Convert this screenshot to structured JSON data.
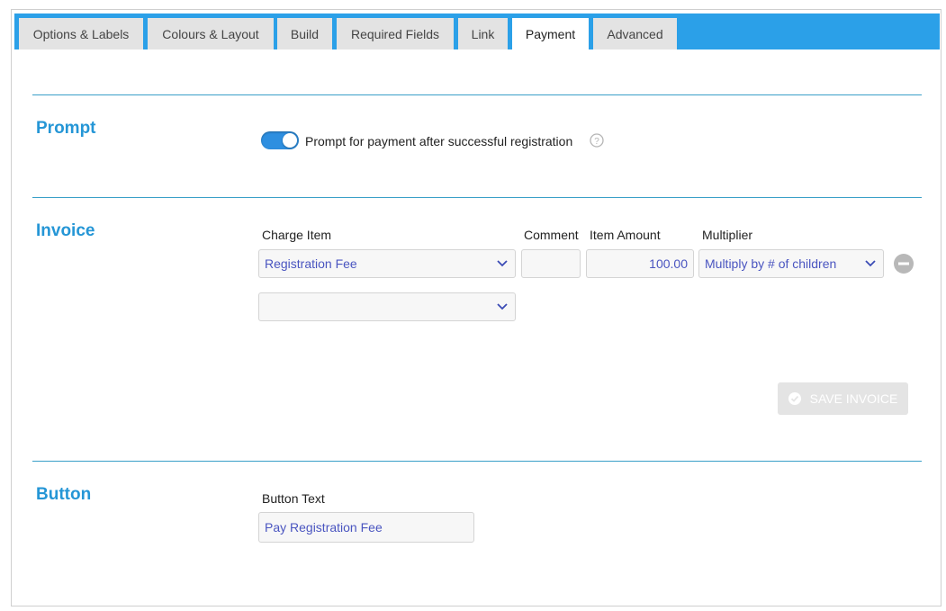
{
  "tabs": [
    {
      "label": "Options & Labels",
      "active": false
    },
    {
      "label": "Colours & Layout",
      "active": false
    },
    {
      "label": "Build",
      "active": false
    },
    {
      "label": "Required Fields",
      "active": false
    },
    {
      "label": "Link",
      "active": false
    },
    {
      "label": "Payment",
      "active": true
    },
    {
      "label": "Advanced",
      "active": false
    }
  ],
  "prompt": {
    "title": "Prompt",
    "toggle_on": true,
    "toggle_label": "Prompt for payment after successful registration",
    "help_icon": "question-circle-icon"
  },
  "invoice": {
    "title": "Invoice",
    "headers": {
      "charge_item": "Charge Item",
      "comment": "Comment",
      "item_amount": "Item Amount",
      "multiplier": "Multiplier"
    },
    "rows": [
      {
        "charge_item": "Registration Fee",
        "comment": "",
        "item_amount": "100.00",
        "multiplier": "Multiply by # of children"
      }
    ],
    "new_row_charge_item": "",
    "save_label": "SAVE INVOICE"
  },
  "button": {
    "title": "Button",
    "field_label": "Button Text",
    "value": "Pay Registration Fee"
  },
  "colors": {
    "tabbar": "#2ba0e8",
    "accent": "#2596d6",
    "toggle": "#2e8fe0",
    "value_text": "#4a55c0"
  }
}
